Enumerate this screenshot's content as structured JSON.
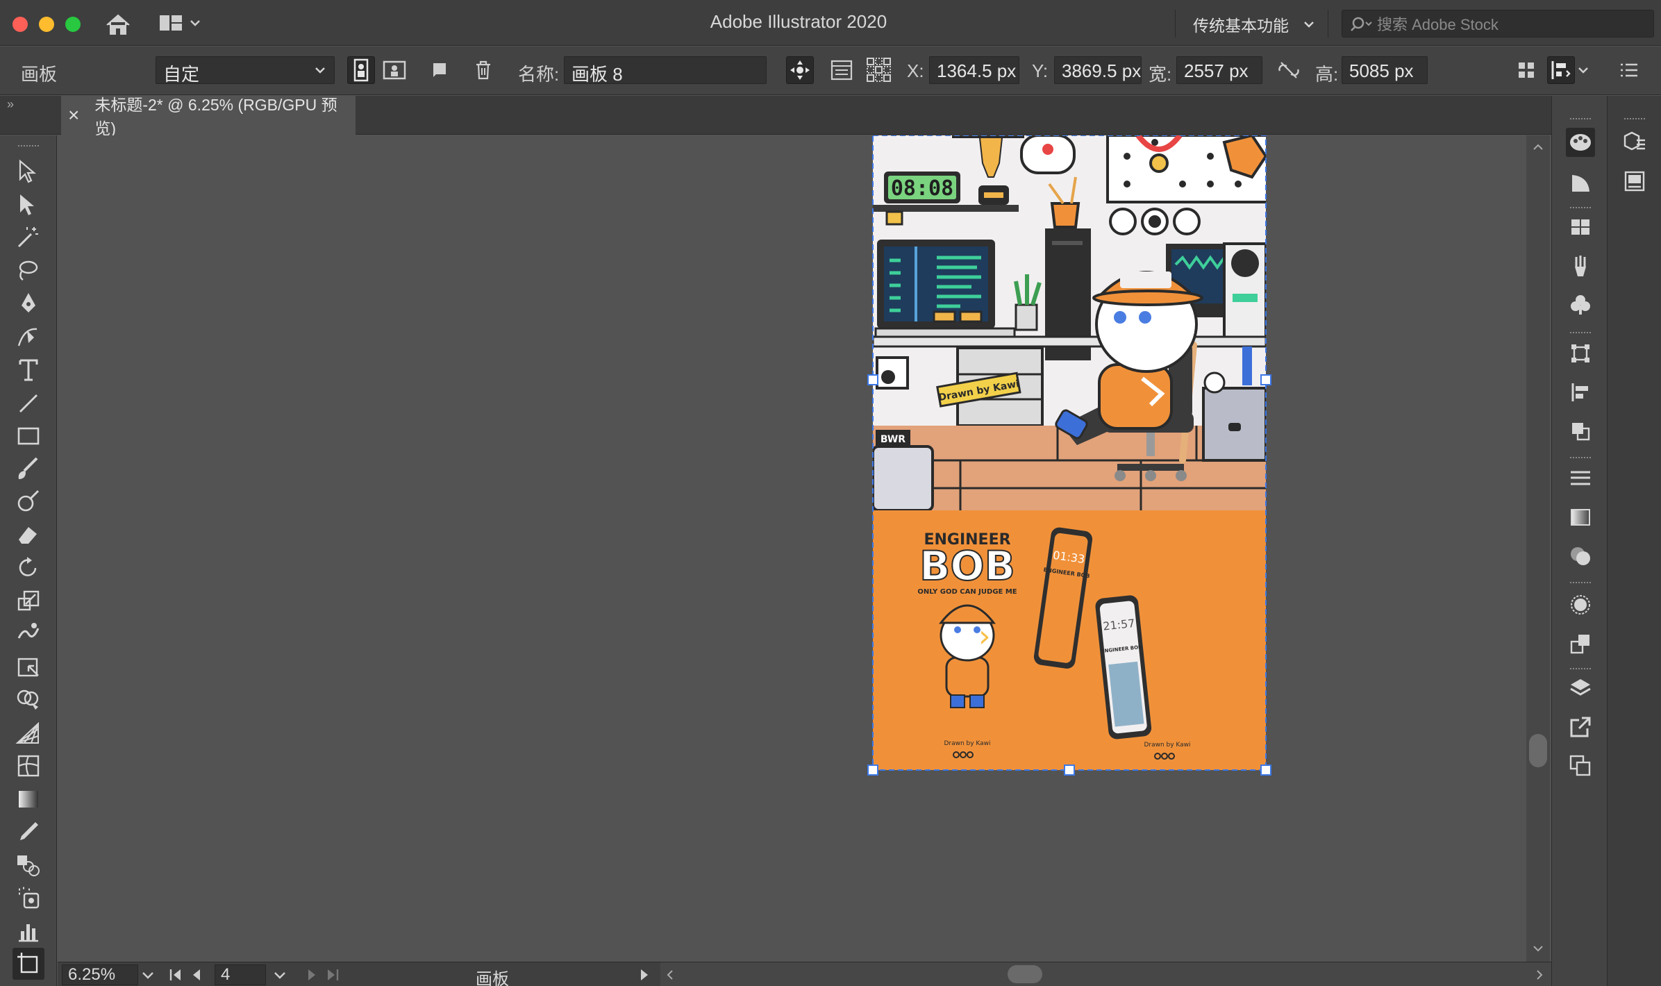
{
  "titlebar": {
    "app_title": "Adobe Illustrator 2020",
    "workspace": "传统基本功能",
    "search_placeholder": "搜索 Adobe Stock"
  },
  "control_bar": {
    "panel_label": "画板",
    "preset": "自定",
    "name_label": "名称:",
    "name_value": "画板 8",
    "x_label": "X:",
    "x_value": "1364.5 px",
    "y_label": "Y:",
    "y_value": "3869.5 px",
    "w_label": "宽:",
    "w_value": "2557 px",
    "h_label": "高:",
    "h_value": "5085 px"
  },
  "document_tab": {
    "close": "×",
    "title": "未标题-2* @ 6.25% (RGB/GPU 预览)"
  },
  "artwork": {
    "clock": "08:08",
    "sticker": "Drawn by Kawi",
    "tag": "BWR",
    "heading_small": "ENGINEER",
    "heading_big": "BOB",
    "tagline": "ONLY GOD CAN JUDGE ME",
    "credit_left": "Drawn by Kawi",
    "credit_right": "Drawn by Kawi",
    "phone1_time": "01:33",
    "phone1_label": "ENGINEER BOB",
    "phone2_time": "21:57",
    "phone2_label": "ENGINEER BOB",
    "arrow": "›"
  },
  "statusbar": {
    "zoom": "6.25%",
    "artboard_num": "4",
    "mode": "画板"
  },
  "tools": [
    "selection-tool-icon",
    "direct-selection-tool-icon",
    "magic-wand-tool-icon",
    "lasso-tool-icon",
    "pen-tool-icon",
    "curvature-tool-icon",
    "type-tool-icon",
    "line-tool-icon",
    "rectangle-tool-icon",
    "paintbrush-tool-icon",
    "shaper-tool-icon",
    "eraser-tool-icon",
    "rotate-tool-icon",
    "scale-tool-icon",
    "warp-tool-icon",
    "free-transform-tool-icon",
    "shape-builder-tool-icon",
    "perspective-grid-tool-icon",
    "mesh-tool-icon",
    "gradient-tool-icon",
    "eyedropper-tool-icon",
    "blend-tool-icon",
    "symbol-sprayer-tool-icon",
    "graph-tool-icon",
    "artboard-tool-icon"
  ],
  "colors": {
    "accent_orange": "#f0913a",
    "selection_blue": "#3b78e8",
    "chrome_dark": "#3e3e3e",
    "canvas": "#535353"
  }
}
